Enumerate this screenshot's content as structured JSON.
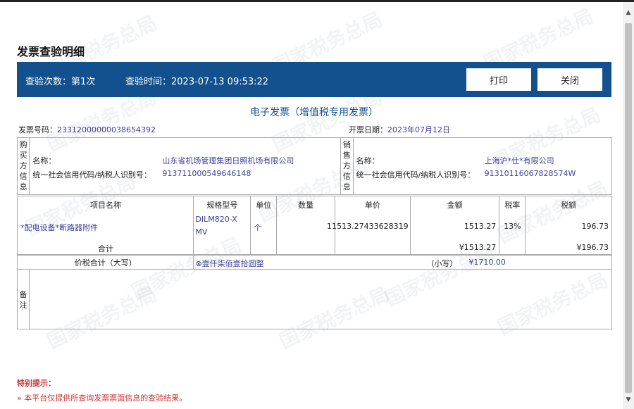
{
  "page_title": "发票查验明细",
  "header_bar": {
    "check_count": "查验次数：第1次",
    "check_time": "查验时间：2023-07-13 09:53:22",
    "print_label": "打印",
    "close_label": "关闭"
  },
  "watermark_text": "国家税务总局",
  "invoice": {
    "title": "电子发票（增值税专用发票）",
    "number_label": "发票号码：",
    "number": "23312000000038654392",
    "date_label": "开票日期：",
    "date": "2023年07月12日",
    "buyer": {
      "section_label": "购买方信息",
      "name_label": "名称：",
      "name": "山东省机场管理集团日照机场有限公司",
      "taxid_label": "统一社会信用代码/纳税人识别号：",
      "taxid": "913711000549646148"
    },
    "seller": {
      "section_label": "销售方信息",
      "name_label": "名称：",
      "name": "上海沪*仕*有限公司",
      "taxid_label": "统一社会信用代码/纳税人识别号：",
      "taxid": "91310116067828574W"
    },
    "columns": [
      "项目名称",
      "规格型号",
      "单位",
      "数量",
      "单价",
      "金额",
      "税率",
      "税额"
    ],
    "item": {
      "name": "*配电设备*断路器附件",
      "model": "DILM820-XMV",
      "unit": "个",
      "quantity": "1",
      "unit_price": "1513.27433628319",
      "amount": "1513.27",
      "tax_rate": "13%",
      "tax": "196.73"
    },
    "total_label": "合计",
    "total_amount": "¥1513.27",
    "total_tax": "¥196.73",
    "total_with_tax_label": "价税合计（大写）",
    "total_with_tax_upper": "⊗壹仟柒佰壹拾圆整",
    "small_label": "（小写）",
    "total_with_tax_lower": "¥1710.00",
    "remarks_label": "备注"
  },
  "notice": {
    "title": "特别提示：",
    "text": "本平台仅提供所查询发票票面信息的查验结果。"
  }
}
